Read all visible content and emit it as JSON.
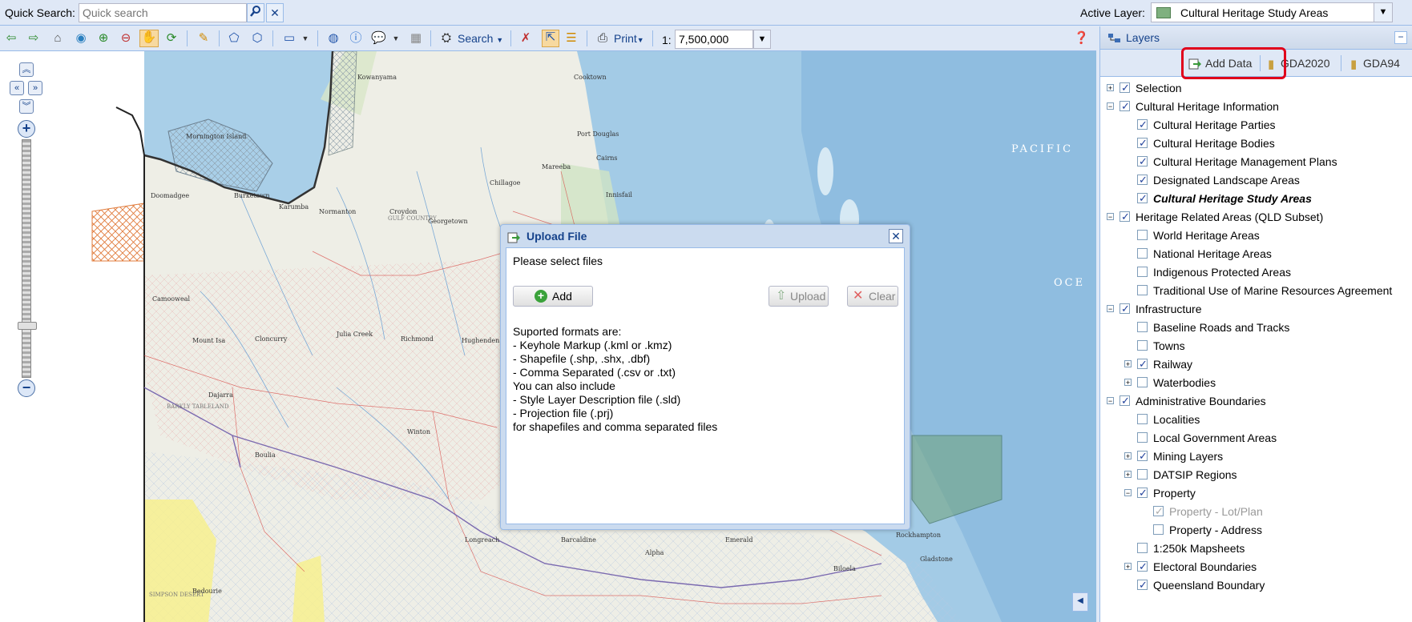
{
  "quick_search": {
    "label": "Quick Search:",
    "placeholder": "Quick search",
    "go_icon": "magnifier-icon",
    "clear_icon": "close-icon"
  },
  "active_layer": {
    "label": "Active Layer:",
    "value": "Cultural Heritage Study Areas"
  },
  "toolbar": {
    "search_label": "Search",
    "print_label": "Print",
    "scale_prefix": "1:",
    "scale_value": "7,500,000"
  },
  "map": {
    "places": [
      "Kowanyama",
      "Cooktown",
      "Port Douglas",
      "Cairns",
      "Mareeba",
      "Chillagoe",
      "Innisfail",
      "Normanton",
      "Karumba",
      "Burketown",
      "Doomadgee",
      "Croydon",
      "Georgetown",
      "Camooweal",
      "Cloncurry",
      "Julia Creek",
      "Richmond",
      "Hughenden",
      "Mount Isa",
      "Dajarra",
      "Winton",
      "Boulia",
      "Longreach",
      "Barcaldine",
      "Alpha",
      "Emerald",
      "Rockhampton",
      "Gladstone",
      "Biloela",
      "Bedourie",
      "Mornington Island"
    ],
    "labels": [
      "PACIFIC",
      "OCE"
    ],
    "regions": [
      "GULF COUNTRY",
      "BARKLY TABLELAND",
      "SIMPSON DESERT"
    ]
  },
  "dialog": {
    "title": "Upload File",
    "prompt": "Please select files",
    "add_label": "Add",
    "upload_label": "Upload",
    "clear_label": "Clear",
    "help_lines": [
      "Suported formats are:",
      "- Keyhole Markup (.kml or .kmz)",
      "- Shapefile (.shp, .shx, .dbf)",
      "- Comma Separated (.csv or .txt)",
      "You can also include",
      "- Style Layer Description file (.sld)",
      "- Projection file (.prj)",
      "for shapefiles and comma separated files"
    ]
  },
  "layers": {
    "title": "Layers",
    "add_data_label": "Add Data",
    "gda2020_label": "GDA2020",
    "gda94_label": "GDA94",
    "items": [
      {
        "label": "Selection",
        "level": 0,
        "expander": "+",
        "checked": true
      },
      {
        "label": "Cultural Heritage Information",
        "level": 0,
        "expander": "-",
        "checked": true
      },
      {
        "label": "Cultural Heritage Parties",
        "level": 1,
        "checked": true
      },
      {
        "label": "Cultural Heritage Bodies",
        "level": 1,
        "checked": true
      },
      {
        "label": "Cultural Heritage Management Plans",
        "level": 1,
        "checked": true
      },
      {
        "label": "Designated Landscape Areas",
        "level": 1,
        "checked": true
      },
      {
        "label": "Cultural Heritage Study Areas",
        "level": 1,
        "checked": true,
        "active": true
      },
      {
        "label": "Heritage Related Areas (QLD Subset)",
        "level": 0,
        "expander": "-",
        "checked": true
      },
      {
        "label": "World Heritage Areas",
        "level": 1,
        "checked": false
      },
      {
        "label": "National Heritage Areas",
        "level": 1,
        "checked": false
      },
      {
        "label": "Indigenous Protected Areas",
        "level": 1,
        "checked": false
      },
      {
        "label": "Traditional Use of Marine Resources Agreement",
        "level": 1,
        "checked": false
      },
      {
        "label": "Infrastructure",
        "level": 0,
        "expander": "-",
        "checked": true
      },
      {
        "label": "Baseline Roads and Tracks",
        "level": 1,
        "checked": false
      },
      {
        "label": "Towns",
        "level": 1,
        "checked": false
      },
      {
        "label": "Railway",
        "level": 1,
        "expander": "+",
        "checked": true
      },
      {
        "label": "Waterbodies",
        "level": 1,
        "expander": "+",
        "checked": false
      },
      {
        "label": "Administrative Boundaries",
        "level": 0,
        "expander": "-",
        "checked": true
      },
      {
        "label": "Localities",
        "level": 1,
        "checked": false
      },
      {
        "label": "Local Government Areas",
        "level": 1,
        "checked": false
      },
      {
        "label": "Mining Layers",
        "level": 1,
        "expander": "+",
        "checked": true
      },
      {
        "label": "DATSIP Regions",
        "level": 1,
        "expander": "+",
        "checked": false
      },
      {
        "label": "Property",
        "level": 1,
        "expander": "-",
        "checked": true
      },
      {
        "label": "Property - Lot/Plan",
        "level": 2,
        "checked": true,
        "disabled": true
      },
      {
        "label": "Property - Address",
        "level": 2,
        "checked": false
      },
      {
        "label": "1:250k Mapsheets",
        "level": 1,
        "checked": false
      },
      {
        "label": "Electoral Boundaries",
        "level": 1,
        "expander": "+",
        "checked": true
      },
      {
        "label": "Queensland Boundary",
        "level": 1,
        "checked": true
      }
    ]
  },
  "colors": {
    "accent": "#15428b",
    "highlight": "#e0001b",
    "panel": "#dfe8f6",
    "sea": "#a9cfe8"
  }
}
